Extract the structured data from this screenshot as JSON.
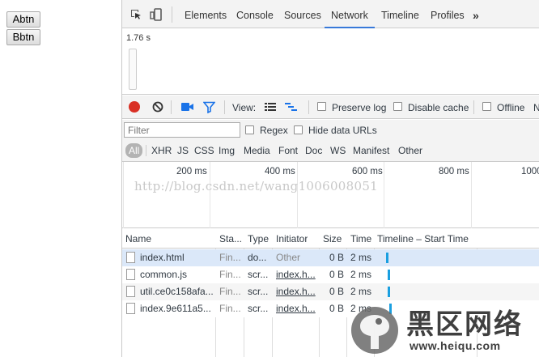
{
  "page": {
    "buttons": [
      "Abtn",
      "Bbtn"
    ]
  },
  "devtools": {
    "tabs": [
      "Elements",
      "Console",
      "Sources",
      "Network",
      "Timeline",
      "Profiles"
    ],
    "active_tab": "Network",
    "more_tabs": "»",
    "overview_time": "1.76 s",
    "toolbar": {
      "view_label": "View:",
      "preserve_log": "Preserve log",
      "disable_cache": "Disable cache",
      "offline": "Offline",
      "cut_label": "N"
    },
    "filter": {
      "placeholder": "Filter",
      "regex": "Regex",
      "hide_data_urls": "Hide data URLs",
      "types": [
        "All",
        "XHR",
        "JS",
        "CSS",
        "Img",
        "Media",
        "Font",
        "Doc",
        "WS",
        "Manifest",
        "Other"
      ],
      "active_type": "All"
    },
    "timeline_ticks": [
      "200 ms",
      "400 ms",
      "600 ms",
      "800 ms",
      "1000"
    ],
    "watermark": "http://blog.csdn.net/wang1006008051",
    "table": {
      "columns": [
        "Name",
        "Sta...",
        "Type",
        "Initiator",
        "Size",
        "Time",
        "Timeline – Start Time"
      ],
      "rows": [
        {
          "name": "index.html",
          "status": "Fin...",
          "type": "do...",
          "initiator": "Other",
          "size": "0 B",
          "time": "2 ms"
        },
        {
          "name": "common.js",
          "status": "Fin...",
          "type": "scr...",
          "initiator": "index.h...",
          "size": "0 B",
          "time": "2 ms"
        },
        {
          "name": "util.ce0c158afa...",
          "status": "Fin...",
          "type": "scr...",
          "initiator": "index.h...",
          "size": "0 B",
          "time": "2 ms"
        },
        {
          "name": "index.9e611a5...",
          "status": "Fin...",
          "type": "scr...",
          "initiator": "index.h...",
          "size": "0 B",
          "time": "2 ms"
        }
      ]
    },
    "colors": {
      "record_red": "#d93025",
      "accent_blue": "#3879d9",
      "waterfall_bar": "#1a9fe0",
      "selected_row": "#dbe8f9"
    }
  },
  "logo": {
    "title": "黑区网络",
    "url": "www.heiqu.com"
  }
}
